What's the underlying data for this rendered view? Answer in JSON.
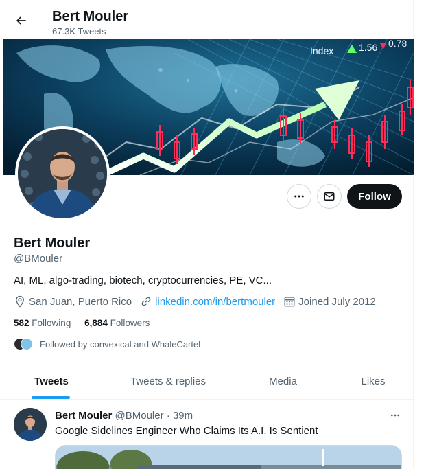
{
  "header": {
    "title": "Bert Mouler",
    "tweet_count": "67.3K Tweets"
  },
  "profile": {
    "name": "Bert Mouler",
    "handle": "@BMouler",
    "bio": "AI, ML, algo-trading, biotech, cryptocurrencies, PE, VC...",
    "location": "San Juan, Puerto Rico",
    "website": "linkedin.com/in/bertmouler",
    "joined": "Joined July 2012",
    "following_count": "582",
    "following_label": "Following",
    "followers_count": "6,884",
    "followers_label": "Followers",
    "followed_by": "Followed by convexical and WhaleCartel"
  },
  "banner": {
    "index_label": "Index",
    "value_left": "1.56",
    "value_right": "0.78"
  },
  "actions": {
    "follow_label": "Follow"
  },
  "tabs": [
    {
      "label": "Tweets"
    },
    {
      "label": "Tweets & replies"
    },
    {
      "label": "Media"
    },
    {
      "label": "Likes"
    }
  ],
  "tweet": {
    "author": "Bert Mouler",
    "handle": "@BMouler",
    "separator": "·",
    "time": "39m",
    "text": "Google Sidelines Engineer Who Claims Its A.I. Is Sentient"
  },
  "colors": {
    "accent": "#1d9bf0",
    "text_primary": "#0f1419",
    "text_secondary": "#536471",
    "follow_button_bg": "#0f1419",
    "banner_bg": "#04253c"
  },
  "icons": {
    "back": "arrow-left-icon",
    "more": "more-horizontal-icon",
    "message": "envelope-icon",
    "location": "location-pin-icon",
    "link": "link-icon",
    "calendar": "calendar-icon"
  }
}
